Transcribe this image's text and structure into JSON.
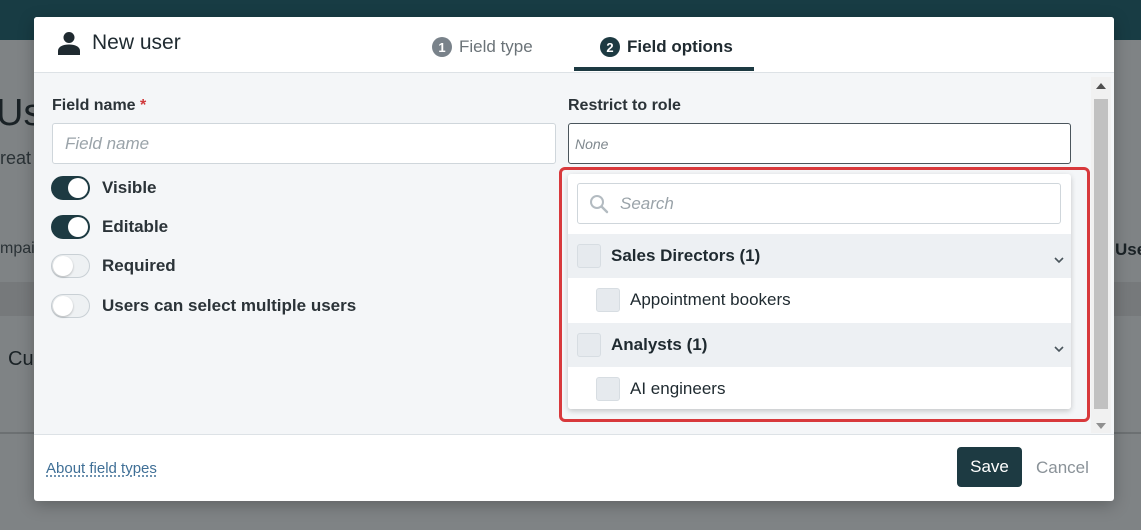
{
  "background": {
    "title_fragment": "Us",
    "subtitle_fragment": "reat",
    "tab_fragment": "mpai",
    "tab_right_fragment": "Use",
    "row_fragment": "Cu"
  },
  "modal": {
    "title": "New user",
    "title_icon": "user-icon",
    "steps": [
      {
        "number": "1",
        "label": "Field type",
        "active": false
      },
      {
        "number": "2",
        "label": "Field options",
        "active": true
      }
    ],
    "field_name": {
      "label": "Field name",
      "required_mark": "*",
      "placeholder": "Field name",
      "value": ""
    },
    "restrict_role": {
      "label": "Restrict to role",
      "value": "None"
    },
    "toggles": [
      {
        "label": "Visible",
        "on": true
      },
      {
        "label": "Editable",
        "on": true
      },
      {
        "label": "Required",
        "on": false
      },
      {
        "label": "Users can select multiple users",
        "on": false
      }
    ],
    "dropdown": {
      "search_placeholder": "Search",
      "groups": [
        {
          "label": "Sales Directors (1)",
          "checked": false,
          "items": [
            {
              "label": "Appointment bookers",
              "checked": false
            }
          ]
        },
        {
          "label": "Analysts (1)",
          "checked": false,
          "items": [
            {
              "label": "AI engineers",
              "checked": false
            }
          ]
        }
      ]
    },
    "footer": {
      "link": "About field types",
      "save": "Save",
      "cancel": "Cancel"
    }
  },
  "colors": {
    "primary": "#1d3a42",
    "highlight": "#d8393c",
    "required": "#d0393b",
    "link": "#3f6f96"
  }
}
